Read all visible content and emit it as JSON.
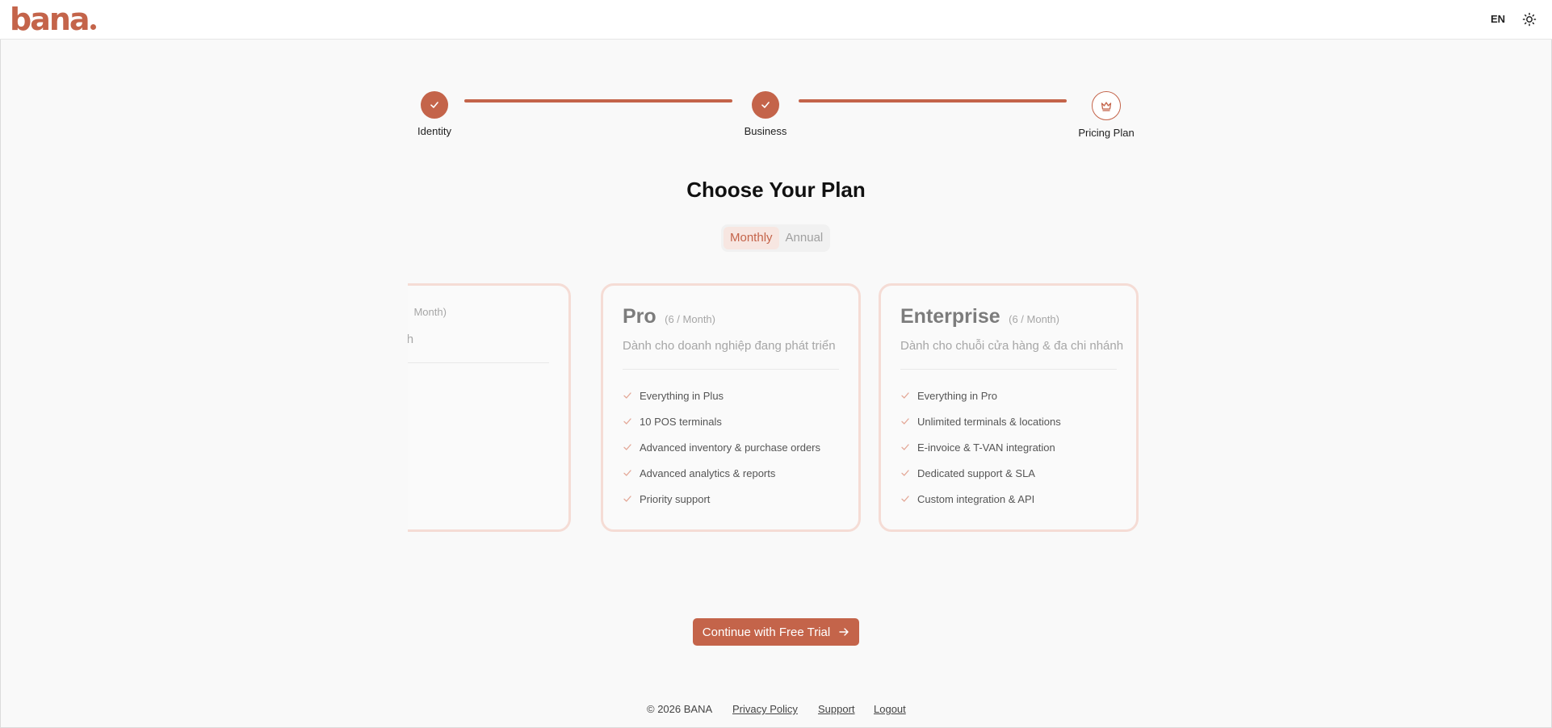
{
  "header": {
    "logo": "bana",
    "language": "EN",
    "theme_icon": "sun-icon"
  },
  "stepper": {
    "steps": [
      {
        "label": "Identity",
        "status": "completed",
        "icon": "check-icon"
      },
      {
        "label": "Business",
        "status": "completed",
        "icon": "check-icon"
      },
      {
        "label": "Pricing Plan",
        "status": "current",
        "icon": "crown-icon"
      }
    ]
  },
  "title": "Choose Your Plan",
  "billing_toggle": {
    "options": [
      "Monthly",
      "Annual"
    ],
    "selected": "Monthly"
  },
  "plans": [
    {
      "name": "",
      "price": "Month)",
      "description": "ửa hàng đã ổn định",
      "features": []
    },
    {
      "name": "Pro",
      "price": "(6 / Month)",
      "description": "Dành cho doanh nghiệp đang phát triển",
      "features": [
        "Everything in Plus",
        "10 POS terminals",
        "Advanced inventory & purchase orders",
        "Advanced analytics & reports",
        "Priority support"
      ]
    },
    {
      "name": "Enterprise",
      "price": "(6 / Month)",
      "description": "Dành cho chuỗi cửa hàng & đa chi nhánh",
      "features": [
        "Everything in Pro",
        "Unlimited terminals & locations",
        "E-invoice & T-VAN integration",
        "Dedicated support & SLA",
        "Custom integration & API"
      ]
    }
  ],
  "cta": {
    "label": "Continue with Free Trial",
    "icon": "arrow-right-icon"
  },
  "footer": {
    "copyright": "© 2026 BANA",
    "links": [
      "Privacy Policy",
      "Support",
      "Logout"
    ]
  },
  "colors": {
    "accent": "#c4644a",
    "accent_soft": "#f7e6e1",
    "card_border": "#f5dcd5",
    "background": "#f9f9f9"
  }
}
